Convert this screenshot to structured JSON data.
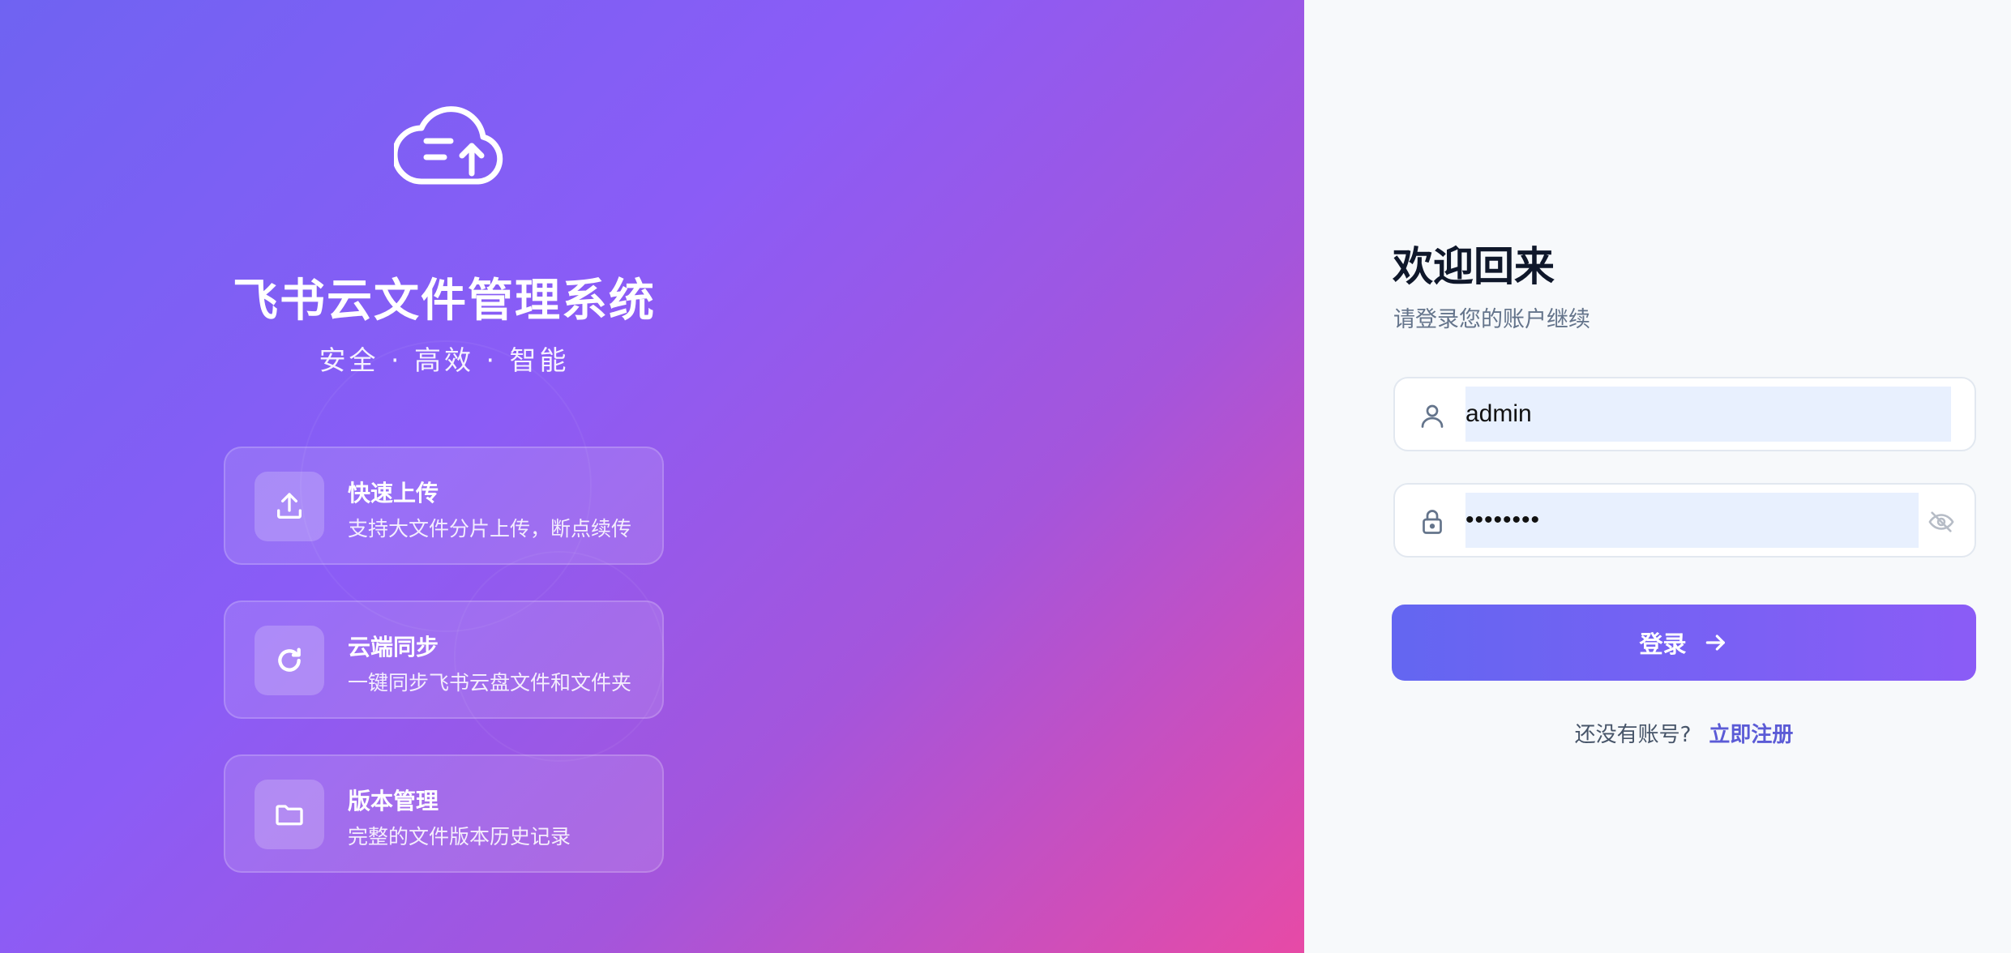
{
  "brand": {
    "title": "飞书云文件管理系统",
    "tagline": "安全 · 高效 · 智能",
    "logo_icon": "cloud-upload-icon"
  },
  "features": [
    {
      "icon": "upload-icon",
      "title": "快速上传",
      "description": "支持大文件分片上传，断点续传"
    },
    {
      "icon": "refresh-icon",
      "title": "云端同步",
      "description": "一键同步飞书云盘文件和文件夹"
    },
    {
      "icon": "folder-icon",
      "title": "版本管理",
      "description": "完整的文件版本历史记录"
    }
  ],
  "login": {
    "title": "欢迎回来",
    "subtitle": "请登录您的账户继续",
    "username_value": "admin",
    "password_value": "••••••••",
    "submit_label": "登录",
    "no_account_text": "还没有账号?",
    "register_link": "立即注册"
  },
  "colors": {
    "gradient_start": "#6f63f2",
    "gradient_mid": "#8b5cf6",
    "gradient_end": "#e74aa6",
    "button_start": "#6366f1",
    "button_end": "#8b5cf6",
    "link": "#5b5bd6",
    "autofill_bg": "#e8f0fe"
  }
}
